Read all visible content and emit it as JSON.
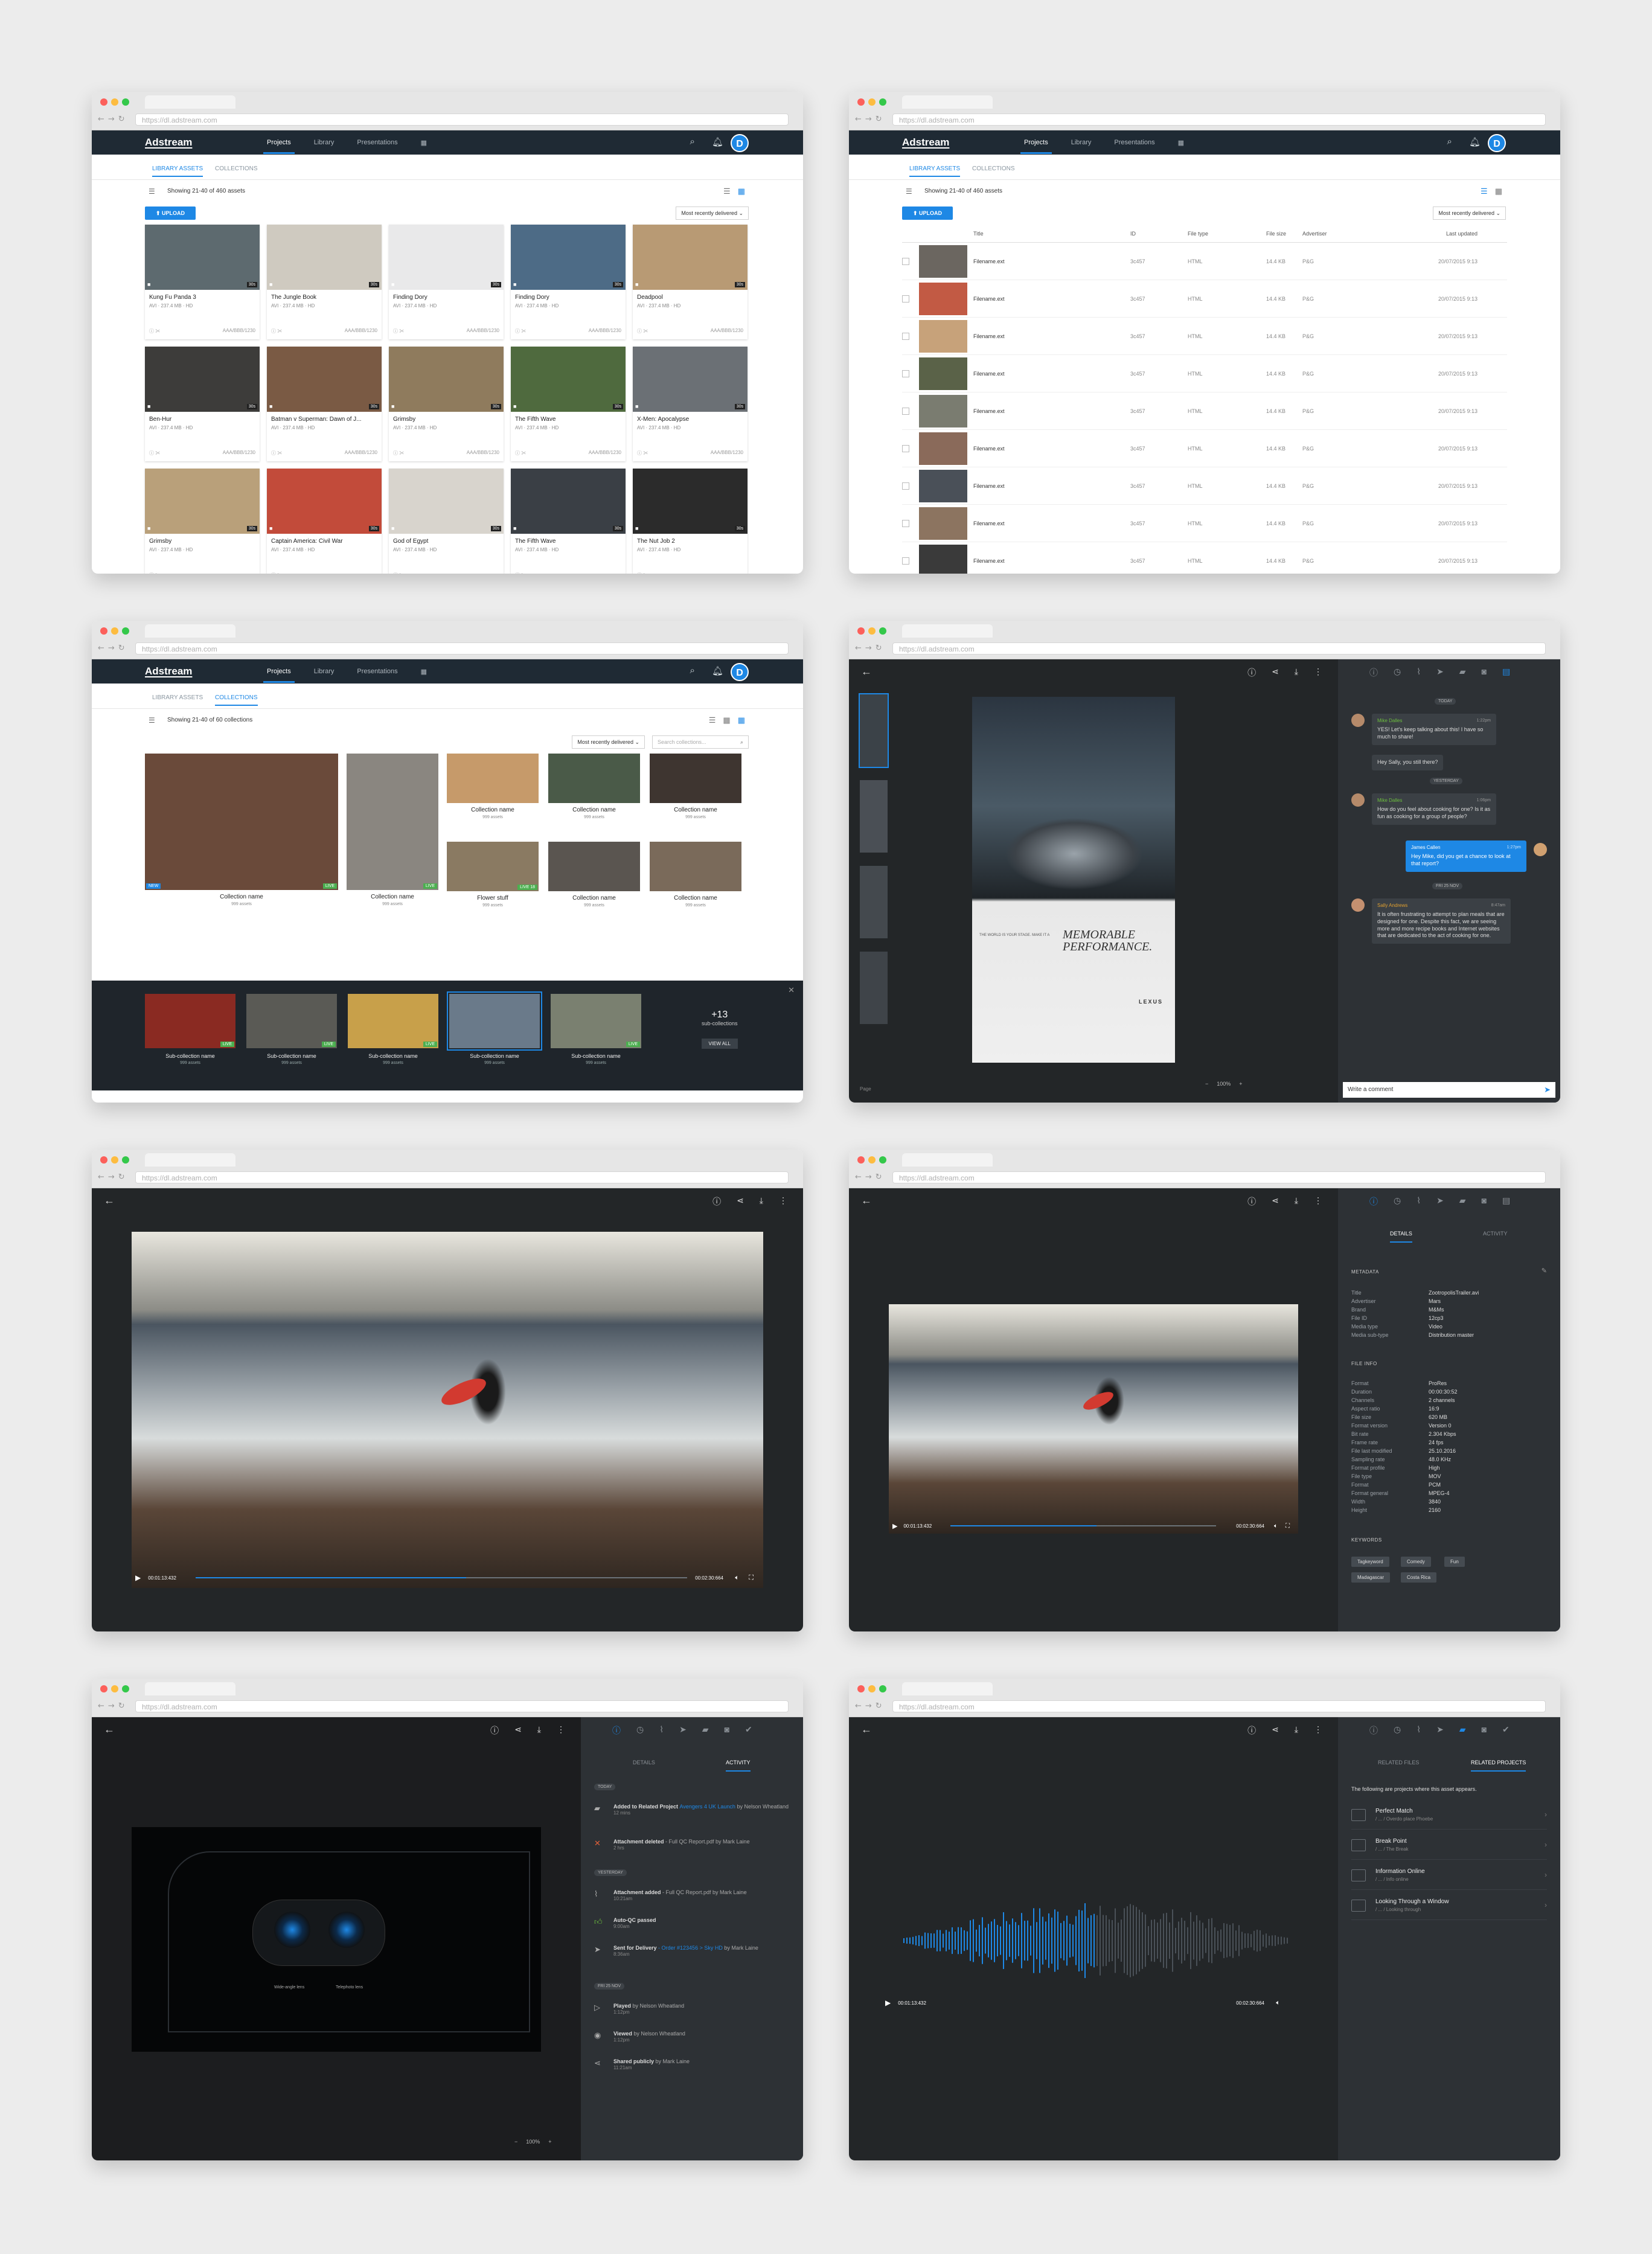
{
  "common": {
    "url": "https://dl.adstream.com",
    "logo": "Adstream",
    "nav": [
      "Projects",
      "Library",
      "Presentations"
    ],
    "avatar_letter": "D"
  },
  "grid_view": {
    "tabs": [
      "LIBRARY ASSETS",
      "COLLECTIONS"
    ],
    "count": "Showing 21-40 of 460 assets",
    "upload": "UPLOAD",
    "sort": "Most recently delivered",
    "cards": [
      {
        "title": "Kung Fu Panda 3",
        "meta": "AVI · 237.4 MB · HD",
        "code": "AAA/BBB/1230",
        "dur": "30s",
        "color": "#5d6a6f"
      },
      {
        "title": "The Jungle Book",
        "meta": "AVI · 237.4 MB · HD",
        "code": "AAA/BBB/1230",
        "dur": "30s",
        "color": "#cfcac0"
      },
      {
        "title": "Finding Dory",
        "meta": "AVI · 237.4 MB · HD",
        "code": "AAA/BBB/1230",
        "dur": "30s",
        "color": "#e9e9ea"
      },
      {
        "title": "Finding Dory",
        "meta": "AVI · 237.4 MB · HD",
        "code": "AAA/BBB/1230",
        "dur": "30s",
        "color": "#4d6b86"
      },
      {
        "title": "Deadpool",
        "meta": "AVI · 237.4 MB · HD",
        "code": "AAA/BBB/1230",
        "dur": "30s",
        "color": "#b89a74"
      },
      {
        "title": "Ben-Hur",
        "meta": "AVI · 237.4 MB · HD",
        "code": "AAA/BBB/1230",
        "dur": "30s",
        "color": "#3d3c3a"
      },
      {
        "title": "Batman v Superman: Dawn of J...",
        "meta": "AVI · 237.4 MB · HD",
        "code": "AAA/BBB/1230",
        "dur": "30s",
        "color": "#7a5a44"
      },
      {
        "title": "Grimsby",
        "meta": "AVI · 237.4 MB · HD",
        "code": "AAA/BBB/1230",
        "dur": "30s",
        "color": "#8f7b5d"
      },
      {
        "title": "The Fifth Wave",
        "meta": "AVI · 237.4 MB · HD",
        "code": "AAA/BBB/1230",
        "dur": "30s",
        "color": "#4f6a3e"
      },
      {
        "title": "X-Men: Apocalypse",
        "meta": "AVI · 237.4 MB · HD",
        "code": "AAA/BBB/1230",
        "dur": "30s",
        "color": "#6b7075"
      },
      {
        "title": "Grimsby",
        "meta": "AVI · 237.4 MB · HD",
        "code": "",
        "dur": "30s",
        "color": "#b9a07a"
      },
      {
        "title": "Captain America: Civil War",
        "meta": "AVI · 237.4 MB · HD",
        "code": "",
        "dur": "30s",
        "color": "#c24b3a"
      },
      {
        "title": "God of Egypt",
        "meta": "AVI · 237.4 MB · HD",
        "code": "",
        "dur": "30s",
        "color": "#d8d4cd"
      },
      {
        "title": "The Fifth Wave",
        "meta": "AVI · 237.4 MB · HD",
        "code": "",
        "dur": "30s",
        "color": "#3a3f45"
      },
      {
        "title": "The Nut Job 2",
        "meta": "AVI · 237.4 MB · HD",
        "code": "",
        "dur": "30s",
        "color": "#2b2b2b"
      }
    ]
  },
  "list_view": {
    "columns": [
      "Title",
      "ID",
      "File type",
      "File size",
      "Advertiser",
      "Last updated"
    ],
    "rows": [
      {
        "name": "Filename.ext",
        "id": "3c457",
        "type": "HTML",
        "size": "14.4 KB",
        "adv": "P&G",
        "date": "20/07/2015 9:13",
        "color": "#6b6660"
      },
      {
        "name": "Filename.ext",
        "id": "3c457",
        "type": "HTML",
        "size": "14.4 KB",
        "adv": "P&G",
        "date": "20/07/2015 9:13",
        "color": "#c25a44"
      },
      {
        "name": "Filename.ext",
        "id": "3c457",
        "type": "HTML",
        "size": "14.4 KB",
        "adv": "P&G",
        "date": "20/07/2015 9:13",
        "color": "#c7a27a"
      },
      {
        "name": "Filename.ext",
        "id": "3c457",
        "type": "HTML",
        "size": "14.4 KB",
        "adv": "P&G",
        "date": "20/07/2015 9:13",
        "color": "#5a6248"
      },
      {
        "name": "Filename.ext",
        "id": "3c457",
        "type": "HTML",
        "size": "14.4 KB",
        "adv": "P&G",
        "date": "20/07/2015 9:13",
        "color": "#7a7c70"
      },
      {
        "name": "Filename.ext",
        "id": "3c457",
        "type": "HTML",
        "size": "14.4 KB",
        "adv": "P&G",
        "date": "20/07/2015 9:13",
        "color": "#8a6a5a"
      },
      {
        "name": "Filename.ext",
        "id": "3c457",
        "type": "HTML",
        "size": "14.4 KB",
        "adv": "P&G",
        "date": "20/07/2015 9:13",
        "color": "#4a5058"
      },
      {
        "name": "Filename.ext",
        "id": "3c457",
        "type": "HTML",
        "size": "14.4 KB",
        "adv": "P&G",
        "date": "20/07/2015 9:13",
        "color": "#8c7460"
      },
      {
        "name": "Filename.ext",
        "id": "3c457",
        "type": "HTML",
        "size": "14.4 KB",
        "adv": "P&G",
        "date": "20/07/2015 9:13",
        "color": "#3a3a3a"
      }
    ]
  },
  "collections_view": {
    "count": "Showing 21-40 of 60 collections",
    "sort": "Most recently delivered",
    "search_placeholder": "Search collections...",
    "items": [
      {
        "name": "Collection name",
        "assets": "999 assets",
        "color": "#6a4a3a"
      },
      {
        "name": "Collection name",
        "assets": "999 assets",
        "color": "#8a8680"
      },
      {
        "name": "Collection name",
        "assets": "999 assets",
        "color": "#c69a6a"
      },
      {
        "name": "Collection name",
        "assets": "999 assets",
        "color": "#4a5a48"
      },
      {
        "name": "Collection name",
        "assets": "999 assets",
        "color": "#3e3530"
      },
      {
        "name": "Flower stuff",
        "assets": "999 assets",
        "color": "#8a7a62"
      },
      {
        "name": "Collection name",
        "assets": "999 assets",
        "color": "#5a5550"
      },
      {
        "name": "Collection name",
        "assets": "999 assets",
        "color": "#7a6a5a"
      }
    ],
    "badge_new": "NEW",
    "badge_live": "LIVE",
    "live_count": "18",
    "sub": [
      {
        "name": "Sub-collection name",
        "assets": "999 assets",
        "color": "#8a2a22"
      },
      {
        "name": "Sub-collection name",
        "assets": "999 assets",
        "color": "#5a5a55"
      },
      {
        "name": "Sub-collection name",
        "assets": "999 assets",
        "color": "#c8a04a"
      },
      {
        "name": "Sub-collection name",
        "assets": "999 assets",
        "color": "#6a7a8a"
      },
      {
        "name": "Sub-collection name",
        "assets": "999 assets",
        "color": "#7a8070"
      }
    ],
    "more_count": "+13",
    "more_label": "sub-collections",
    "view_all": "VIEW ALL",
    "bottom_colors": [
      "#6a6e74",
      "#8a8a88",
      "#7a6a5a",
      "#c8904a",
      "#9a9a9a",
      "#a29584"
    ]
  },
  "print_view": {
    "ad_line1": "THE WORLD IS YOUR STAGE. MAKE IT A",
    "ad_line2": "MEMORABLE PERFORMANCE.",
    "ad_brand": "LEXUS",
    "page": "Page",
    "zoom": "100%",
    "chat": {
      "today": "TODAY",
      "yesterday": "YESTERDAY",
      "date3": "FRI 25 NOV",
      "m1_who": "Mike Dalles",
      "m1_time": "1:22pm",
      "m1_text": "YES! Let's keep talking about this! I have so much to share!",
      "m2_text": "Hey Sally, you still there?",
      "m3_who": "Mike Dalles",
      "m3_time": "1:06pm",
      "m3_text": "How do you feel about cooking for one? Is it as fun as cooking for a group of people?",
      "m4_who": "James Callen",
      "m4_time": "1:27pm",
      "m4_text": "Hey Mike, did you get a chance to look at that report?",
      "m5_who": "Sally Andrews",
      "m5_time": "8:47am",
      "m5_text": "It is often frustrating to attempt to plan meals that are designed for one. Despite this fact, we are seeing more and more recipe books and Internet websites that are dedicated to the act of cooking for one.",
      "placeholder": "Write a comment"
    }
  },
  "video_view": {
    "time": "00:01:13:432",
    "dur": "00:02:30:664",
    "progress": 0.55
  },
  "details_view": {
    "tabs": [
      "DETAILS",
      "ACTIVITY"
    ],
    "metadata_title": "METADATA",
    "metadata": [
      [
        "Title",
        "ZootropolisTrailer.avi"
      ],
      [
        "Advertiser",
        "Mars"
      ],
      [
        "Brand",
        "M&Ms"
      ],
      [
        "File ID",
        "12cp3"
      ],
      [
        "Media type",
        "Video"
      ],
      [
        "Media sub-type",
        "Distribution master"
      ]
    ],
    "fileinfo_title": "FILE INFO",
    "fileinfo": [
      [
        "Format",
        "ProRes"
      ],
      [
        "Duration",
        "00:00:30:52"
      ],
      [
        "Channels",
        "2 channels"
      ],
      [
        "Aspect ratio",
        "16:9"
      ],
      [
        "File size",
        "620 MB"
      ],
      [
        "Format version",
        "Version 0"
      ],
      [
        "Bit rate",
        "2.304 Kbps"
      ],
      [
        "Frame rate",
        "24 fps"
      ],
      [
        "File last modified",
        "25.10.2016"
      ],
      [
        "Sampling rate",
        "48.0 KHz"
      ],
      [
        "Format profile",
        "High"
      ],
      [
        "File type",
        "MOV"
      ],
      [
        "Format",
        "PCM"
      ],
      [
        "Format general",
        "MPEG-4"
      ],
      [
        "Width",
        "3840"
      ],
      [
        "Height",
        "2160"
      ]
    ],
    "keywords_title": "KEYWORDS",
    "keywords": [
      "Tagkeyword",
      "Comedy",
      "Fun",
      "Madagascar",
      "Costa Rica"
    ]
  },
  "activity_view": {
    "tabs": [
      "DETAILS",
      "ACTIVITY"
    ],
    "zoom": "100%",
    "label1": "Wide-angle lens",
    "label2": "Telephoto lens",
    "groups": [
      {
        "day": "TODAY",
        "items": [
          {
            "icon": "folder-icon",
            "pre": "Added to Related Project ",
            "link": "Avengers 4 UK Launch",
            "post": " by Nelson Wheatland",
            "time": "12 mins"
          },
          {
            "icon": "close-icon",
            "pre": "Attachment deleted",
            "link": "",
            "post": " - Full QC Report.pdf by Mark Laine",
            "time": "2 hrs"
          }
        ]
      },
      {
        "day": "YESTERDAY",
        "items": [
          {
            "icon": "paperclip-icon",
            "pre": "Attachment added",
            "link": "",
            "post": " - Full QC Report.pdf by Mark Laine",
            "time": "10:21am"
          },
          {
            "icon": "thumbs-up-icon",
            "pre": "Auto-QC passed",
            "link": "",
            "post": "",
            "time": "9:00am"
          },
          {
            "icon": "send-icon",
            "pre": "Sent for Delivery",
            "link": " - Order #123456 > Sky HD",
            "post": " by Mark Laine",
            "time": "8:36am"
          }
        ]
      },
      {
        "day": "FRI 25 NOV",
        "items": [
          {
            "icon": "play-icon",
            "pre": "Played",
            "link": "",
            "post": " by Nelson Wheatland",
            "time": "1:12pm"
          },
          {
            "icon": "eye-icon",
            "pre": "Viewed",
            "link": "",
            "post": " by Nelson Wheatland",
            "time": "1:12pm"
          },
          {
            "icon": "share-icon",
            "pre": "Shared publicly",
            "link": "",
            "post": " by Mark Laine",
            "time": "11:21am"
          }
        ]
      }
    ]
  },
  "audio_view": {
    "time": "00:01:13:432",
    "dur": "00:02:30:664",
    "tabs": [
      "RELATED FILES",
      "RELATED PROJECTS"
    ],
    "intro": "The following are projects where this asset appears.",
    "projects": [
      {
        "title": "Perfect Match",
        "sub": "/ ... / Overdo place Phoebe"
      },
      {
        "title": "Break Point",
        "sub": "/ ... / The Break"
      },
      {
        "title": "Information Online",
        "sub": "/ ... / Info online"
      },
      {
        "title": "Looking Through a Window",
        "sub": "/ ... / Looking through"
      }
    ]
  }
}
